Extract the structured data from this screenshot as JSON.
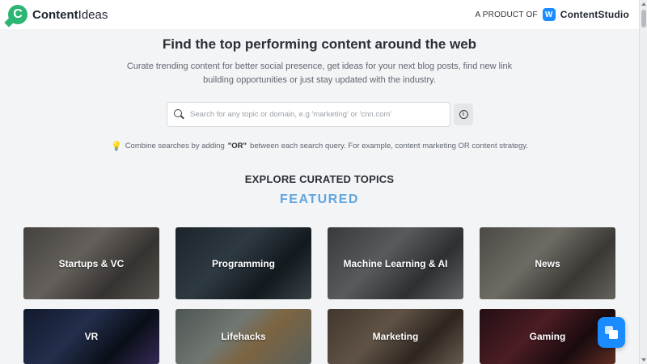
{
  "header": {
    "brand_letter": "C",
    "brand_bold": "Content",
    "brand_rest": "Ideas",
    "product_of": "A PRODUCT OF",
    "partner_icon": "W",
    "partner_name": "ContentStudio"
  },
  "hero": {
    "headline": "Find the top performing content around the web",
    "subhead": "Curate trending content for better social presence, get ideas for your next blog posts, find new link building opportunities or just stay updated with the industry."
  },
  "search": {
    "value": "",
    "placeholder": "Search for any topic or domain, e.g 'marketing' or 'cnn.com'",
    "info_icon": "i"
  },
  "tip": {
    "icon": "💡",
    "before": "Combine searches by adding",
    "keyword": "\"OR\"",
    "after": "between each search query. For example, content marketing OR content strategy."
  },
  "topics": {
    "explore_title": "EXPLORE CURATED TOPICS",
    "featured_title": "FEATURED",
    "cards": [
      {
        "label": "Startups & VC"
      },
      {
        "label": "Programming"
      },
      {
        "label": "Machine Learning & AI"
      },
      {
        "label": "News"
      },
      {
        "label": "VR"
      },
      {
        "label": "Lifehacks"
      },
      {
        "label": "Marketing"
      },
      {
        "label": "Gaming"
      }
    ]
  },
  "colors": {
    "brand_green": "#2bb673",
    "accent_blue": "#1a8cff",
    "featured_blue": "#5fa4df"
  }
}
